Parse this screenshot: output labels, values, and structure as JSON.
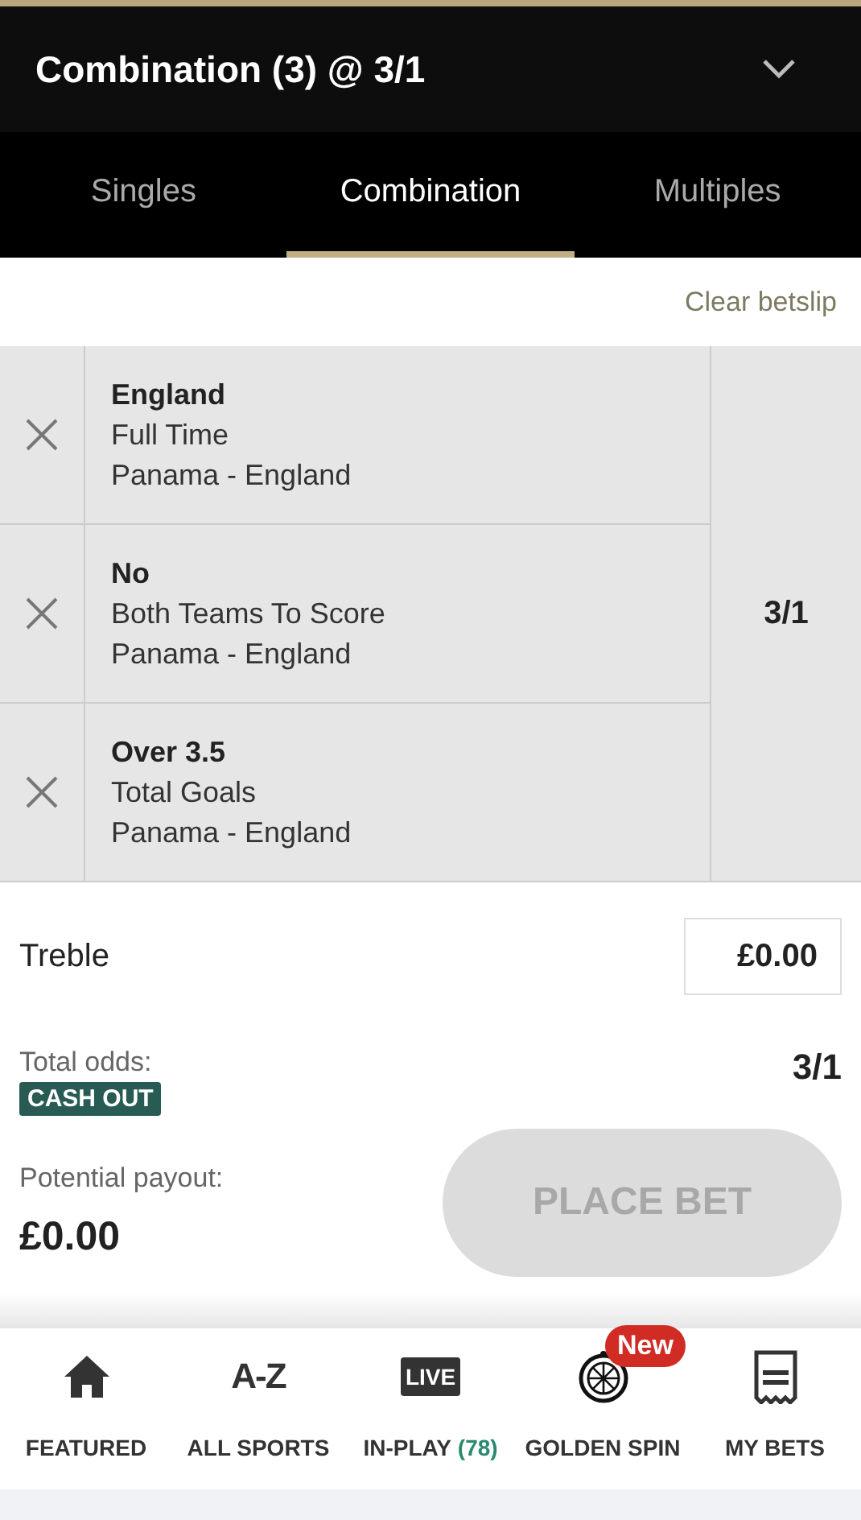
{
  "header": {
    "title": "Combination (3) @ 3/1"
  },
  "tabs": [
    {
      "label": "Singles",
      "selected": false
    },
    {
      "label": "Combination",
      "selected": true
    },
    {
      "label": "Multiples",
      "selected": false
    }
  ],
  "clear_link": "Clear betslip",
  "selections": [
    {
      "pick": "England",
      "market": "Full Time",
      "event": "Panama - England"
    },
    {
      "pick": "No",
      "market": "Both Teams To Score",
      "event": "Panama - England"
    },
    {
      "pick": "Over 3.5",
      "market": "Total Goals",
      "event": "Panama - England"
    }
  ],
  "combined_odds": "3/1",
  "stake": {
    "label": "Treble",
    "value": "£0.00"
  },
  "total_odds": {
    "label": "Total odds:",
    "value": "3/1",
    "badge": "CASH OUT"
  },
  "payout": {
    "label": "Potential payout:",
    "value": "£0.00"
  },
  "place_bet": {
    "label": "PLACE BET",
    "disabled": true
  },
  "nav": [
    {
      "kind": "home",
      "label": "FEATURED"
    },
    {
      "kind": "text",
      "icon_text": "A-Z",
      "label": "ALL SPORTS"
    },
    {
      "kind": "live",
      "icon_text": "LIVE",
      "label": "IN-PLAY",
      "count": "(78)"
    },
    {
      "kind": "wheel",
      "label": "GOLDEN SPIN",
      "badge": "New"
    },
    {
      "kind": "receipt",
      "label": "MY BETS"
    }
  ]
}
